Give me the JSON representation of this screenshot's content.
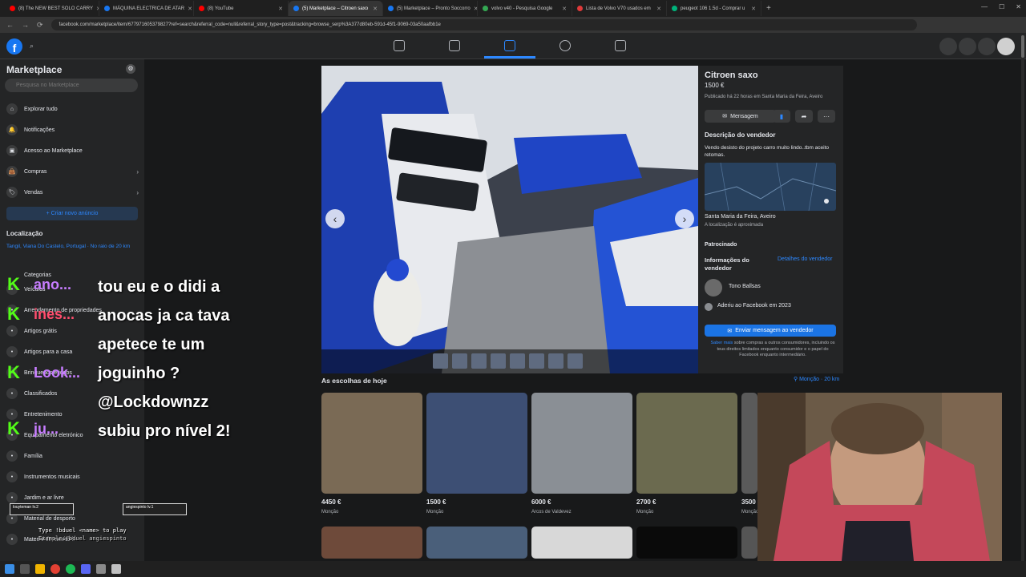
{
  "tabs": [
    {
      "label": "(8) The NEW BEST SOLO CARRY",
      "color": "#ff0000"
    },
    {
      "label": "MÁQUINA ELECTRICA DE ATAR",
      "color": "#1877f2"
    },
    {
      "label": "(8) YouTube",
      "color": "#ff0000"
    },
    {
      "label": "(5) Marketplace – Citroen saxo",
      "color": "#1877f2",
      "active": true
    },
    {
      "label": "(5) Marketplace – Pronto Soccorro",
      "color": "#1877f2"
    },
    {
      "label": "volvo v40 - Pesquisa Google",
      "color": "#34a853"
    },
    {
      "label": "Lista de Volvo V70 usados em",
      "color": "#e03a3a"
    },
    {
      "label": "peugeot 106 1.5d - Comprar u",
      "color": "#00b27a"
    }
  ],
  "url": "facebook.com/marketplace/item/677971605379827?ref=search&referral_code=null&referral_story_type=post&tracking=browse_serp%3A377d80eb-591d-45f1-9069-03a50aafbb1e",
  "sidebar": {
    "title": "Marketplace",
    "search_placeholder": "Pesquisa no Marketplace",
    "items": [
      {
        "label": "Explorar tudo",
        "icon": "store-icon"
      },
      {
        "label": "Notificações",
        "icon": "bell-icon"
      },
      {
        "label": "Acesso ao Marketplace",
        "icon": "inbox-icon"
      },
      {
        "label": "Compras",
        "icon": "bag-icon",
        "chevron": true
      },
      {
        "label": "Vendas",
        "icon": "tag-icon",
        "chevron": true
      }
    ],
    "create_label": "+ Criar novo anúncio",
    "location_title": "Localização",
    "location_text": "Tangil, Viana Do Castelo, Portugal · No raio de 20 km",
    "categories_header": "Categorias",
    "categories": [
      {
        "label": "Veículos",
        "top": 0
      },
      {
        "label": "Arrendamento de propriedades",
        "top": 0
      },
      {
        "label": "Artigos grátis",
        "top": 0
      },
      {
        "label": "Artigos para a casa",
        "top": 0
      },
      {
        "label": "Brinquedos e jogos",
        "top": 0
      },
      {
        "label": "Classificados",
        "top": 0
      },
      {
        "label": "Entretenimento",
        "top": 0
      },
      {
        "label": "Equipamento eletrónico",
        "top": 0
      },
      {
        "label": "Família",
        "top": 0
      },
      {
        "label": "Instrumentos musicais",
        "top": 0
      },
      {
        "label": "Jardim e ar livre",
        "top": 0
      },
      {
        "label": "Material de desporto",
        "top": 0
      },
      {
        "label": "Material de escritório",
        "top": 0
      }
    ]
  },
  "listing": {
    "title": "Citroen saxo",
    "price": "1500 €",
    "published": "Publicado há 22 horas em Santa Maria da Feira, Aveiro",
    "message_label": "Mensagem",
    "desc_header": "Descrição do vendedor",
    "description": "Vendo desisto do projeto carro muito lindo..tbm aceito retomas.",
    "location": "Santa Maria da Feira, Aveiro",
    "location_note": "A localização é aproximada",
    "sponsored": "Patrocinado",
    "seller_info_header": "Informações do vendedor",
    "seller_details_link": "Detalhes do vendedor",
    "seller_name": "Tono Ballsas",
    "joined": "Aderiu ao Facebook em 2023",
    "send_label": "Enviar mensagem ao vendedor",
    "legal_link": "Saber mais",
    "legal_text": " sobre compras a outros consumidores, incluindo os teus direitos limitados enquanto consumidor e o papel do Facebook enquanto intermediário."
  },
  "picks": {
    "title": "As escolhas de hoje",
    "location": "Monção · 20 km",
    "cards": [
      {
        "price": "4450 €",
        "location": "Monção",
        "color": "#7a6a55"
      },
      {
        "price": "1500 €",
        "location": "Monção",
        "color": "#3d4f74"
      },
      {
        "price": "6000 €",
        "location": "Arcos de Valdevez",
        "color": "#8a8f95"
      },
      {
        "price": "2700 €",
        "location": "Monção",
        "color": "#6b6a4f"
      },
      {
        "price": "3500 €",
        "location": "Monção",
        "color": "#5a5a5a"
      }
    ]
  },
  "chat": {
    "names": [
      {
        "name": "ano...",
        "color": "#c77dff"
      },
      {
        "name": "ines...",
        "color": "#ff4d6d"
      },
      {
        "name": "Look...",
        "color": "#c77dff"
      },
      {
        "name": "ju...",
        "color": "#c77dff"
      }
    ],
    "message": "tou eu e o didi a anocas ja ca tava apetece te um joguinho ? @Lockdownzz subiu pro nível 2!",
    "bar1": "louyteman lv.2",
    "bar2": "angiespinto lv.1",
    "duel_line1": "Type !bduel <name> to play",
    "duel_line2": "Example:!bduel angiespinto"
  }
}
